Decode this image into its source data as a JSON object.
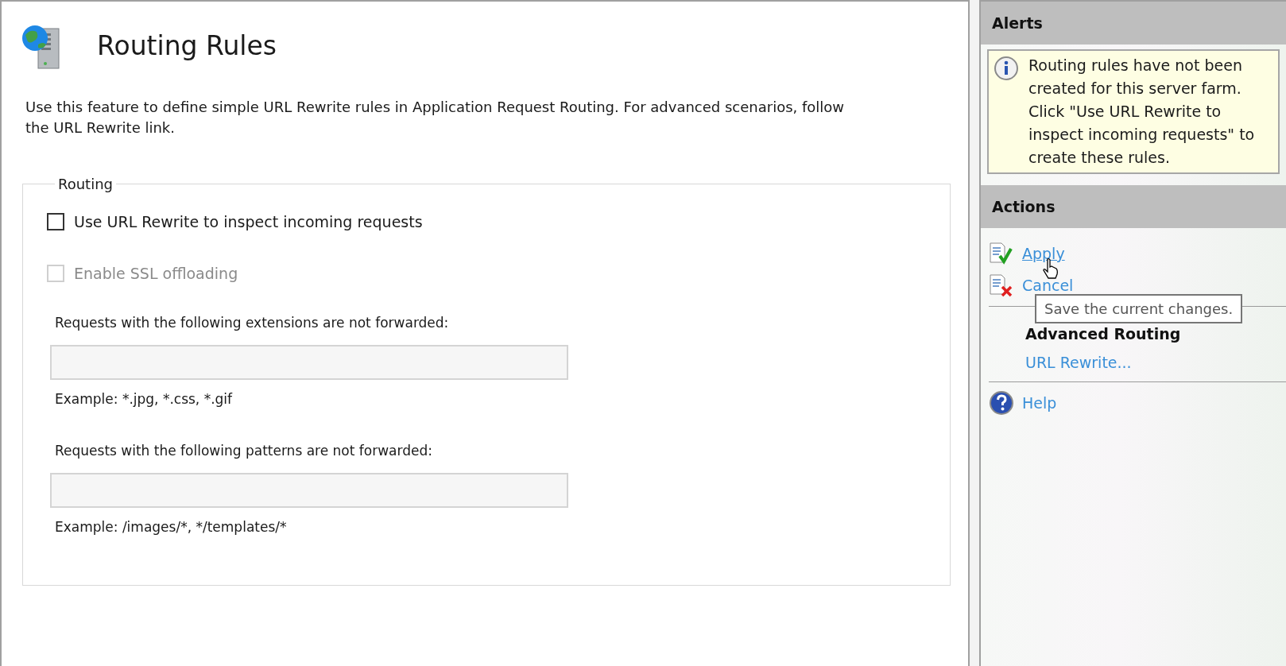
{
  "page": {
    "title": "Routing Rules",
    "description": "Use this feature to define simple URL Rewrite rules in Application Request Routing.  For advanced scenarios, follow the URL Rewrite link."
  },
  "routing": {
    "legend": "Routing",
    "options": [
      {
        "label": "Use URL Rewrite to inspect incoming requests",
        "checked": false,
        "disabled": false
      },
      {
        "label": "Enable SSL offloading",
        "checked": false,
        "disabled": true
      }
    ],
    "fields": [
      {
        "label": "Requests with the following extensions are not forwarded:",
        "example": "Example: *.jpg, *.css, *.gif"
      },
      {
        "label": "Requests with the following patterns are not forwarded:",
        "example": "Example: /images/*, */templates/*"
      }
    ]
  },
  "alerts": {
    "title": "Alerts",
    "message": "Routing rules have not been created for this server farm. Click \"Use URL Rewrite to inspect incoming requests\" to create these rules."
  },
  "actions": {
    "title": "Actions",
    "items": [
      {
        "kind": "apply",
        "label": "Apply",
        "hovered": true
      },
      {
        "kind": "cancel",
        "label": "Cancel",
        "hovered": false
      },
      {
        "kind": "separator"
      },
      {
        "kind": "heading",
        "label": "Advanced Routing"
      },
      {
        "kind": "link",
        "label": "URL Rewrite..."
      },
      {
        "kind": "separator"
      },
      {
        "kind": "help",
        "label": "Help"
      }
    ]
  },
  "tooltip": "Save the current changes."
}
